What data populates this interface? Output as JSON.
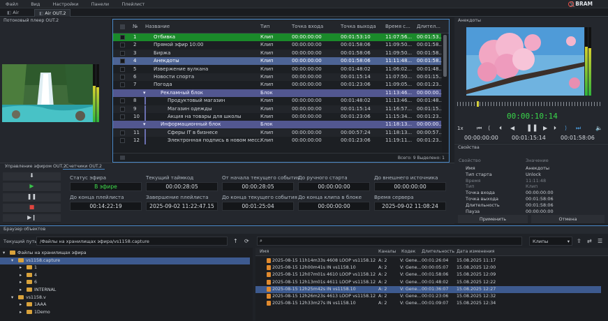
{
  "menu": [
    "Файл",
    "Вид",
    "Настройки",
    "Панели",
    "Плейлист"
  ],
  "logo": "BRAM",
  "tabs": [
    "Air",
    "Air OUT.2"
  ],
  "player_title": "Потоковый плеер OUT.2",
  "playlist": {
    "headers": [
      "№",
      "Название",
      "Тип",
      "Точка входа",
      "Точка выхода",
      "Время с...",
      "Длител..."
    ],
    "rows": [
      {
        "n": "1",
        "name": "Отбивка",
        "type": "Клип",
        "in": "00:00:00:00",
        "out": "00:01:53:10",
        "time": "11:07:56...",
        "dur": "00:01:53...",
        "style": "green",
        "indent": 0
      },
      {
        "n": "2",
        "name": "Прямой эфир 10:00",
        "type": "Клип",
        "in": "00:00:00:00",
        "out": "00:01:58:06",
        "time": "11:09:50...",
        "dur": "00:01:58...",
        "style": "",
        "indent": 0
      },
      {
        "n": "3",
        "name": "Биржа",
        "type": "Клип",
        "in": "00:00:00:00",
        "out": "00:01:58:06",
        "time": "11:09:50...",
        "dur": "00:01:58...",
        "style": "odd",
        "indent": 0
      },
      {
        "n": "4",
        "name": "Анекдоты",
        "type": "Клип",
        "in": "00:00:00:00",
        "out": "00:01:58:06",
        "time": "11:11:48...",
        "dur": "00:01:58...",
        "style": "blue",
        "indent": 0
      },
      {
        "n": "5",
        "name": "Извержение вулкана",
        "type": "Клип",
        "in": "00:00:00:00",
        "out": "00:01:48:02",
        "time": "11:06:02...",
        "dur": "00:01:48...",
        "style": "",
        "indent": 0
      },
      {
        "n": "6",
        "name": "Новости спорта",
        "type": "Клип",
        "in": "00:00:00:00",
        "out": "00:01:15:14",
        "time": "11:07:50...",
        "dur": "00:01:15...",
        "style": "odd",
        "indent": 0
      },
      {
        "n": "7",
        "name": "Погода",
        "type": "Клип",
        "in": "00:00:00:00",
        "out": "00:01:23:06",
        "time": "11:09:05...",
        "dur": "00:01:23...",
        "style": "",
        "indent": 0
      },
      {
        "n": "",
        "name": "Рекламный блок",
        "type": "Блок",
        "in": "",
        "out": "",
        "time": "11:13:46...",
        "dur": "00:00:00...",
        "style": "block",
        "indent": 1
      },
      {
        "n": "8",
        "name": "Продуктовый магазин",
        "type": "Клип",
        "in": "00:00:00:00",
        "out": "00:01:48:02",
        "time": "11:13:46...",
        "dur": "00:01:48...",
        "style": "",
        "indent": 2
      },
      {
        "n": "9",
        "name": "Магазин одежды",
        "type": "Клип",
        "in": "00:00:00:00",
        "out": "00:01:15:14",
        "time": "11:16:57...",
        "dur": "00:01:15...",
        "style": "odd",
        "indent": 2
      },
      {
        "n": "10",
        "name": "Акция на товары для школы",
        "type": "Клип",
        "in": "00:00:00:00",
        "out": "00:01:23:06",
        "time": "11:15:34...",
        "dur": "00:01:23...",
        "style": "",
        "indent": 2
      },
      {
        "n": "",
        "name": "Информационный блок",
        "type": "Блок",
        "in": "",
        "out": "",
        "time": "11:18:13...",
        "dur": "00:00:00...",
        "style": "block",
        "indent": 1
      },
      {
        "n": "11",
        "name": "Сферы IT в бизнесе",
        "type": "Клип",
        "in": "00:00:00:00",
        "out": "00:00:57:24",
        "time": "11:18:13...",
        "dur": "00:00:57...",
        "style": "odd",
        "indent": 2
      },
      {
        "n": "12",
        "name": "Электронная подпись в новом месс...",
        "type": "Клип",
        "in": "00:00:00:00",
        "out": "00:01:23:06",
        "time": "11:19:11...",
        "dur": "00:01:23...",
        "style": "",
        "indent": 2
      }
    ],
    "footer": "Всего: 9 Выделено: 1"
  },
  "preview": {
    "title": "Анекдоты",
    "timecode": "00:00:10:14",
    "speed": "1x",
    "in_tc": "00:00:00:00",
    "out_tc": "00:01:15:14",
    "dur_tc": "00:01:58:06"
  },
  "properties": {
    "title": "Свойства",
    "col_prop": "Свойство",
    "col_val": "Значение",
    "rows": [
      {
        "k": "Имя",
        "v": "Анекдоты",
        "dim": false
      },
      {
        "k": "Тип старта",
        "v": "Unlock",
        "dim": false
      },
      {
        "k": "Время",
        "v": "11:11:48",
        "dim": true
      },
      {
        "k": "Тип",
        "v": "Клип",
        "dim": true
      },
      {
        "k": "Точка входа",
        "v": "00:00:00:00",
        "dim": false
      },
      {
        "k": "Точка выхода",
        "v": "00:01:58:06",
        "dim": false
      },
      {
        "k": "Длительность",
        "v": "00:01:58:06",
        "dim": false
      },
      {
        "k": "Пауза",
        "v": "00:00:00:00",
        "dim": false
      }
    ],
    "apply": "Применить",
    "cancel": "Отмена"
  },
  "control_title": "Управление эфиром OUT.2",
  "counters_tab": "Счетчики OUT.2",
  "counters": [
    {
      "label": "Статус эфира",
      "value": "В эфире",
      "green": true
    },
    {
      "label": "Текущий таймкод",
      "value": "00:00:28:05",
      "green": false
    },
    {
      "label": "От начала текущего события",
      "value": "00:00:28:05",
      "green": false
    },
    {
      "label": "До ручного старта",
      "value": "00:00:00:00",
      "green": false
    },
    {
      "label": "До внешнего источника",
      "value": "00:00:00:00",
      "green": false
    },
    {
      "label": "До конца плейлиста",
      "value": "00:14:22:19",
      "green": false
    },
    {
      "label": "Завершение плейлиста",
      "value": "2025-09-02 11:22:47.15",
      "green": false
    },
    {
      "label": "До конца текущего события",
      "value": "00:01:25:04",
      "green": false
    },
    {
      "label": "До конца клипа в блоке",
      "value": "00:00:00:00",
      "green": false
    },
    {
      "label": "Время сервера",
      "value": "2025-09-02 11:08:24",
      "green": false
    }
  ],
  "browser": {
    "title": "Браузер объектов",
    "path_label": "Текущий путь:",
    "path": "/Файлы на хранилищах эфира/vs1158.capture",
    "filter": "Клипы",
    "tree": [
      {
        "label": "Файлы на хранилищах эфира",
        "level": 0,
        "open": true,
        "sel": false
      },
      {
        "label": "vs1158.capture",
        "level": 1,
        "open": true,
        "sel": true
      },
      {
        "label": "1",
        "level": 2,
        "open": false,
        "sel": false
      },
      {
        "label": "4",
        "level": 2,
        "open": false,
        "sel": false
      },
      {
        "label": "6",
        "level": 2,
        "open": false,
        "sel": false
      },
      {
        "label": "INTERNAL",
        "level": 2,
        "open": false,
        "sel": false
      },
      {
        "label": "vs1158.v",
        "level": 1,
        "open": true,
        "sel": false
      },
      {
        "label": "1AAA",
        "level": 2,
        "open": false,
        "sel": false
      },
      {
        "label": "1Demo",
        "level": 2,
        "open": false,
        "sel": false
      }
    ],
    "headers": [
      "Имя",
      "Каналы",
      "Кодек",
      "Длительность",
      "Дата изменения"
    ],
    "files": [
      {
        "name": "2025-08-15 11h14m33s 4608 LOOP vs1158.12",
        "ch": "A: 2",
        "codec": "V: Gene...",
        "dur": "00:01:26:04",
        "date": "15.08.2025 11:17",
        "sel": false
      },
      {
        "name": "2025-08-15 12h00m41s IN vs1158.10",
        "ch": "A: 2",
        "codec": "V: Gene...",
        "dur": "00:00:05:07",
        "date": "15.08.2025 12:00",
        "sel": false
      },
      {
        "name": "2025-08-15 12h07m01s 4610 LOOP vs1158.12",
        "ch": "A: 2",
        "codec": "V: Gene...",
        "dur": "00:01:58:06",
        "date": "15.08.2025 12:09",
        "sel": false
      },
      {
        "name": "2025-08-15 12h13m01s 4611 LOOP vs1158.12",
        "ch": "A: 2",
        "codec": "V: Gene...",
        "dur": "00:01:48:02",
        "date": "15.08.2025 12:22",
        "sel": false
      },
      {
        "name": "2025-08-15 12h25m42s IN vs1158.10",
        "ch": "A: 2",
        "codec": "V: Gene...",
        "dur": "00:01:36:07",
        "date": "15.08.2025 12:27",
        "sel": true
      },
      {
        "name": "2025-08-15 12h26m23s 4613 LOOP vs1158.12",
        "ch": "A: 2",
        "codec": "V: Gene...",
        "dur": "00:01:23:06",
        "date": "15.08.2025 12:32",
        "sel": false
      },
      {
        "name": "2025-08-15 12h33m27s IN vs1158.10",
        "ch": "A: 2",
        "codec": "V: Gene...",
        "dur": "00:01:09:07",
        "date": "15.08.2025 12:34",
        "sel": false
      }
    ]
  }
}
